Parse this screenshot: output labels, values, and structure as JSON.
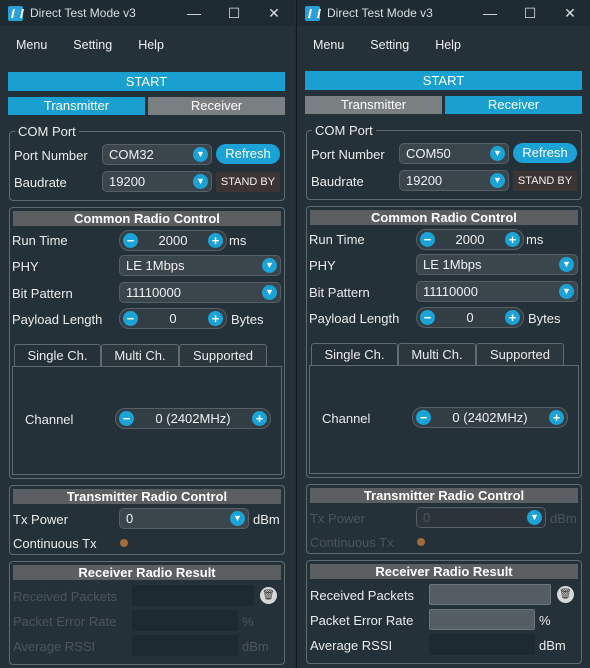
{
  "windows": [
    {
      "id": "tx",
      "title": "Direct Test Mode v3",
      "menu": [
        "Menu",
        "Setting",
        "Help"
      ],
      "start": "START",
      "mode_tabs": [
        "Transmitter",
        "Receiver"
      ],
      "active_mode": "Transmitter",
      "com": {
        "group": "COM Port",
        "port_label": "Port Number",
        "port": "COM32",
        "refresh": "Refresh",
        "baud_label": "Baudrate",
        "baud": "19200",
        "status": "STAND BY"
      },
      "common": {
        "header": "Common Radio Control",
        "run_time_label": "Run Time",
        "run_time": "2000",
        "run_time_unit": "ms",
        "phy_label": "PHY",
        "phy": "LE 1Mbps",
        "bit_label": "Bit Pattern",
        "bit": "11110000",
        "payload_label": "Payload Length",
        "payload": "0",
        "payload_unit": "Bytes",
        "tabs": [
          "Single Ch.",
          "Multi Ch.",
          "Supported"
        ],
        "channel_label": "Channel",
        "channel": "0 (2402MHz)"
      },
      "tx": {
        "header": "Transmitter Radio Control",
        "power_label": "Tx Power",
        "power": "0",
        "power_unit": "dBm",
        "cont_label": "Continuous Tx"
      },
      "rx": {
        "header": "Receiver Radio Result",
        "packets_label": "Received Packets",
        "per_label": "Packet Error Rate",
        "per_unit": "%",
        "rssi_label": "Average RSSI",
        "rssi_unit": "dBm"
      }
    },
    {
      "id": "rx",
      "title": "Direct Test Mode v3",
      "menu": [
        "Menu",
        "Setting",
        "Help"
      ],
      "start": "START",
      "mode_tabs": [
        "Transmitter",
        "Receiver"
      ],
      "active_mode": "Receiver",
      "com": {
        "group": "COM Port",
        "port_label": "Port Number",
        "port": "COM50",
        "refresh": "Refresh",
        "baud_label": "Baudrate",
        "baud": "19200",
        "status": "STAND BY"
      },
      "common": {
        "header": "Common Radio Control",
        "run_time_label": "Run Time",
        "run_time": "2000",
        "run_time_unit": "ms",
        "phy_label": "PHY",
        "phy": "LE 1Mbps",
        "bit_label": "Bit Pattern",
        "bit": "11110000",
        "payload_label": "Payload Length",
        "payload": "0",
        "payload_unit": "Bytes",
        "tabs": [
          "Single Ch.",
          "Multi Ch.",
          "Supported"
        ],
        "channel_label": "Channel",
        "channel": "0 (2402MHz)"
      },
      "tx": {
        "header": "Transmitter Radio Control",
        "power_label": "Tx Power",
        "power": "0",
        "power_unit": "dBm",
        "cont_label": "Continuous Tx"
      },
      "rx": {
        "header": "Receiver Radio Result",
        "packets_label": "Received Packets",
        "per_label": "Packet Error Rate",
        "per_unit": "%",
        "rssi_label": "Average RSSI",
        "rssi_unit": "dBm"
      }
    }
  ],
  "colors": {
    "accent": "#1ba2d6",
    "inactive_tab": "#7a7f82",
    "status_bg": "#3d3534",
    "window_bg": "#243138"
  }
}
